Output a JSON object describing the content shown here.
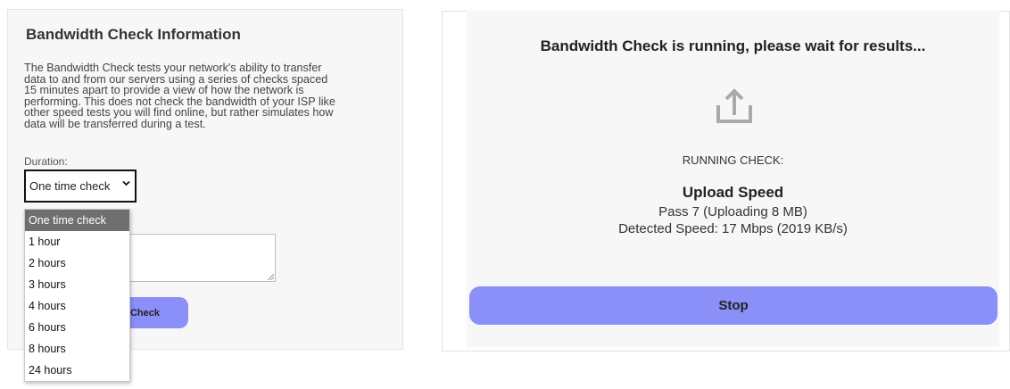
{
  "info_panel": {
    "title": "Bandwidth Check Information",
    "description_lines": [
      "The Bandwidth Check tests your network's ability to transfer",
      "data to and from our servers using a series of checks spaced",
      "15 minutes apart to provide a view of how the network is",
      "performing. This does not check the bandwidth of your ISP like",
      "other speed tests you will find online, but rather simulates how",
      "data will be transferred during a test."
    ],
    "duration_label": "Duration:",
    "duration_selected": "One time check",
    "duration_options": [
      "One time check",
      "1 hour",
      "2 hours",
      "3 hours",
      "4 hours",
      "6 hours",
      "8 hours",
      "24 hours"
    ],
    "start_button_label_visible": "Check"
  },
  "status_panel": {
    "title": "Bandwidth Check is running, please wait for results...",
    "icon": "upload-icon",
    "running_label": "RUNNING CHECK:",
    "test_name": "Upload Speed",
    "pass_info": "Pass 7 (Uploading 8 MB)",
    "speed_info": "Detected Speed: 17 Mbps (2019 KB/s)",
    "stop_label": "Stop"
  },
  "colors": {
    "accent_button": "#8b8ff8",
    "panel_bg": "#f7f7f7",
    "selected_option_bg": "#6f6f6f"
  }
}
